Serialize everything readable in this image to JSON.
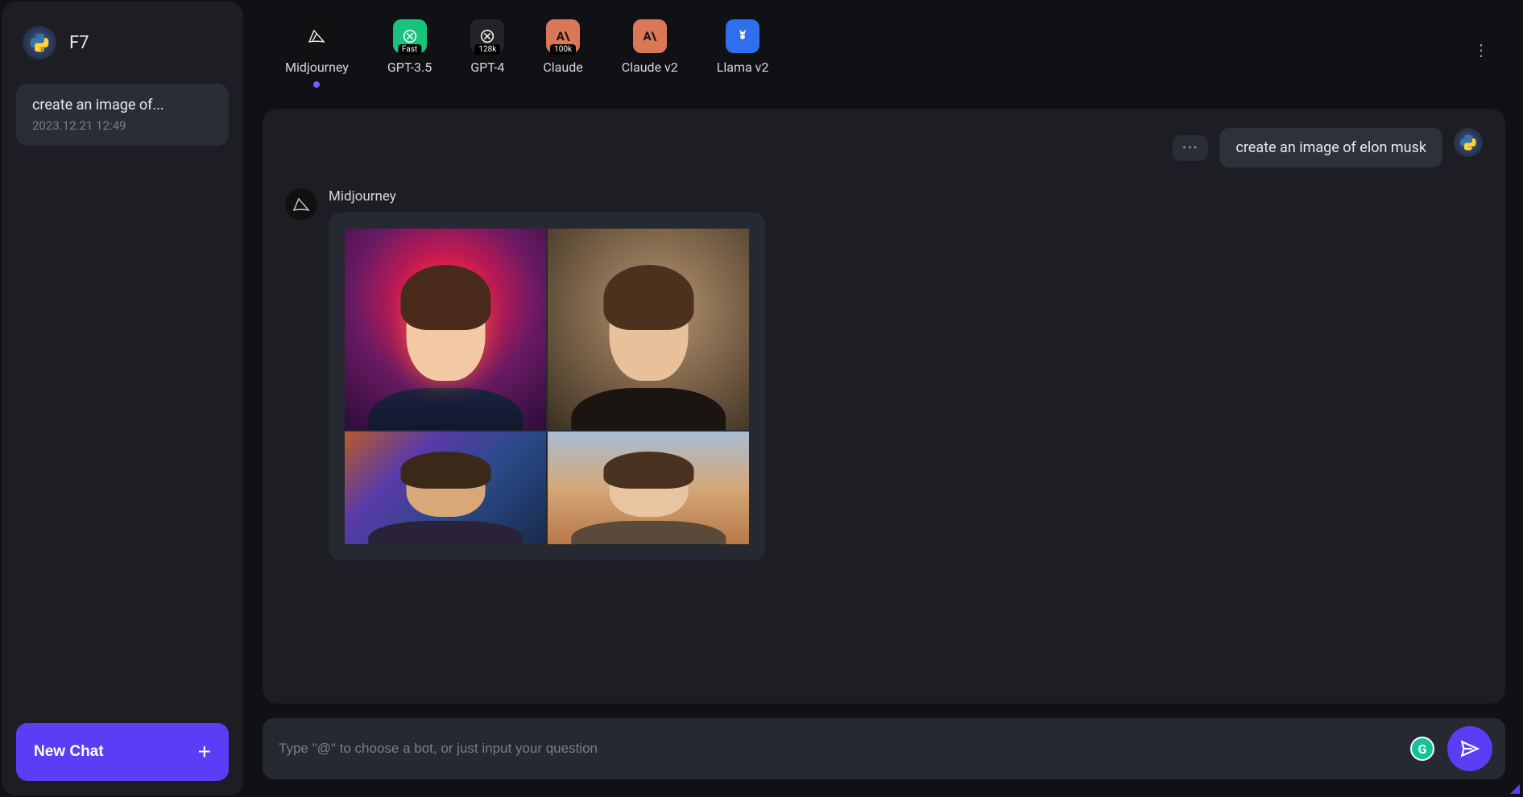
{
  "sidebar": {
    "workspace_label": "F7",
    "chats": [
      {
        "title": "create an image of...",
        "timestamp": "2023.12.21 12:49"
      }
    ],
    "new_chat_label": "New Chat"
  },
  "models": [
    {
      "id": "midjourney",
      "label": "Midjourney",
      "badge": "",
      "icon_bg": "#111111",
      "active": true
    },
    {
      "id": "gpt35",
      "label": "GPT-3.5",
      "badge": "Fast",
      "icon_bg": "#19c37d",
      "active": false
    },
    {
      "id": "gpt4",
      "label": "GPT-4",
      "badge": "128k",
      "icon_bg": "#222427",
      "active": false
    },
    {
      "id": "claude",
      "label": "Claude",
      "badge": "100k",
      "icon_bg": "#d97757",
      "active": false
    },
    {
      "id": "claude2",
      "label": "Claude v2",
      "badge": "",
      "icon_bg": "#d97757",
      "active": false
    },
    {
      "id": "llama2",
      "label": "Llama v2",
      "badge": "",
      "icon_bg": "#2f6fed",
      "active": false
    }
  ],
  "conversation": {
    "user_message": "create an image of elon musk",
    "bot_name": "Midjourney"
  },
  "input": {
    "placeholder": "Type \"@\" to choose a bot, or just input your question"
  },
  "colors": {
    "accent": "#5b3df5",
    "panel": "#1c1e24",
    "bubble": "#2e313a"
  }
}
